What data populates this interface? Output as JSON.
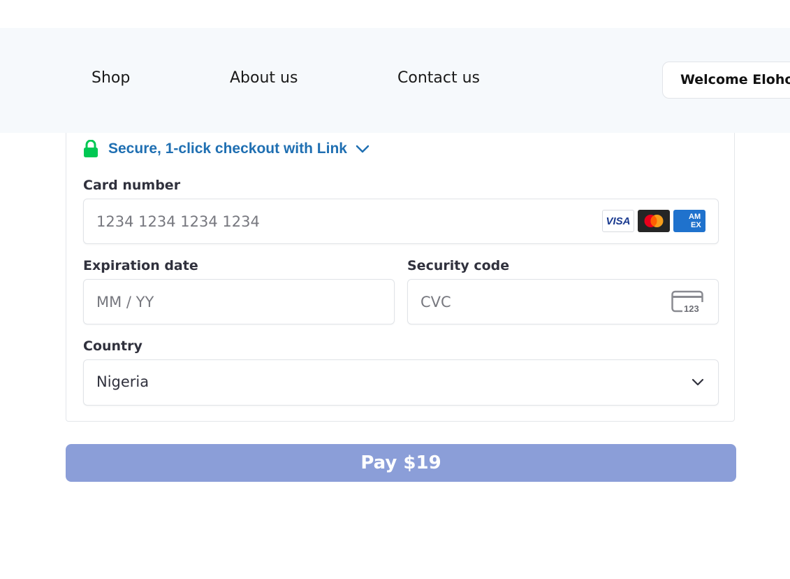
{
  "nav": {
    "shop": "Shop",
    "about": "About us",
    "contact": "Contact us",
    "welcome": "Welcome Eloho"
  },
  "checkout": {
    "link_text": "Secure, 1-click checkout with Link",
    "card_number": {
      "label": "Card number",
      "placeholder": "1234 1234 1234 1234",
      "brands": [
        "VISA",
        "Mastercard",
        "AMEX"
      ]
    },
    "expiration": {
      "label": "Expiration date",
      "placeholder": "MM / YY"
    },
    "security": {
      "label": "Security code",
      "placeholder": "CVC",
      "icon_text": "123"
    },
    "country": {
      "label": "Country",
      "value": "Nigeria"
    }
  },
  "pay_button": "Pay $19",
  "colors": {
    "header_bg": "#f6f9fc",
    "link_blue": "#1f6fb2",
    "lock_green": "#00c853",
    "pay_button_bg": "#8b9ed8"
  }
}
